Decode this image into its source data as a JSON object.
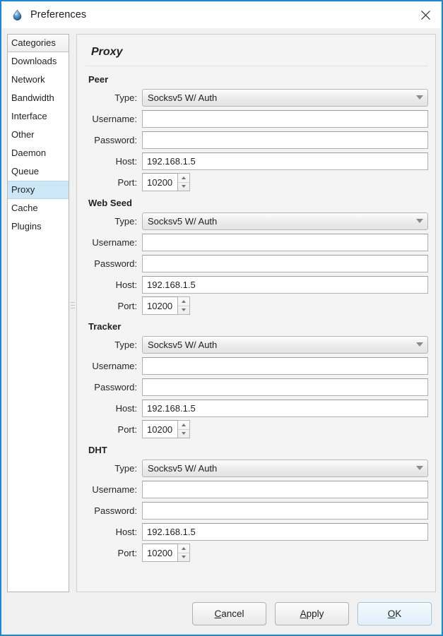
{
  "window": {
    "title": "Preferences",
    "icon": "water-drop-icon",
    "close_label": "×",
    "accent_border": "#1a88d9"
  },
  "sidebar": {
    "header": "Categories",
    "selected": "Proxy",
    "selection_color": "#cde7f7",
    "items": [
      {
        "label": "Downloads"
      },
      {
        "label": "Network"
      },
      {
        "label": "Bandwidth"
      },
      {
        "label": "Interface"
      },
      {
        "label": "Other"
      },
      {
        "label": "Daemon"
      },
      {
        "label": "Queue"
      },
      {
        "label": "Proxy"
      },
      {
        "label": "Cache"
      },
      {
        "label": "Plugins"
      }
    ]
  },
  "panel": {
    "title": "Proxy",
    "labels": {
      "type": "Type:",
      "username": "Username:",
      "password": "Password:",
      "host": "Host:",
      "port": "Port:"
    },
    "groups": [
      {
        "title": "Peer",
        "type_value": "Socksv5 W/ Auth",
        "username_value": "",
        "password_value": "",
        "host_value": "192.168.1.5",
        "port_value": "10200"
      },
      {
        "title": "Web Seed",
        "type_value": "Socksv5 W/ Auth",
        "username_value": "",
        "password_value": "",
        "host_value": "192.168.1.5",
        "port_value": "10200"
      },
      {
        "title": "Tracker",
        "type_value": "Socksv5 W/ Auth",
        "username_value": "",
        "password_value": "",
        "host_value": "192.168.1.5",
        "port_value": "10200"
      },
      {
        "title": "DHT",
        "type_value": "Socksv5 W/ Auth",
        "username_value": "",
        "password_value": "",
        "host_value": "192.168.1.5",
        "port_value": "10200"
      }
    ]
  },
  "footer": {
    "cancel": {
      "mnemonic": "C",
      "rest": "ancel"
    },
    "apply": {
      "mnemonic": "A",
      "rest": "pply"
    },
    "ok": {
      "mnemonic": "O",
      "rest": "K",
      "is_default": true
    }
  }
}
